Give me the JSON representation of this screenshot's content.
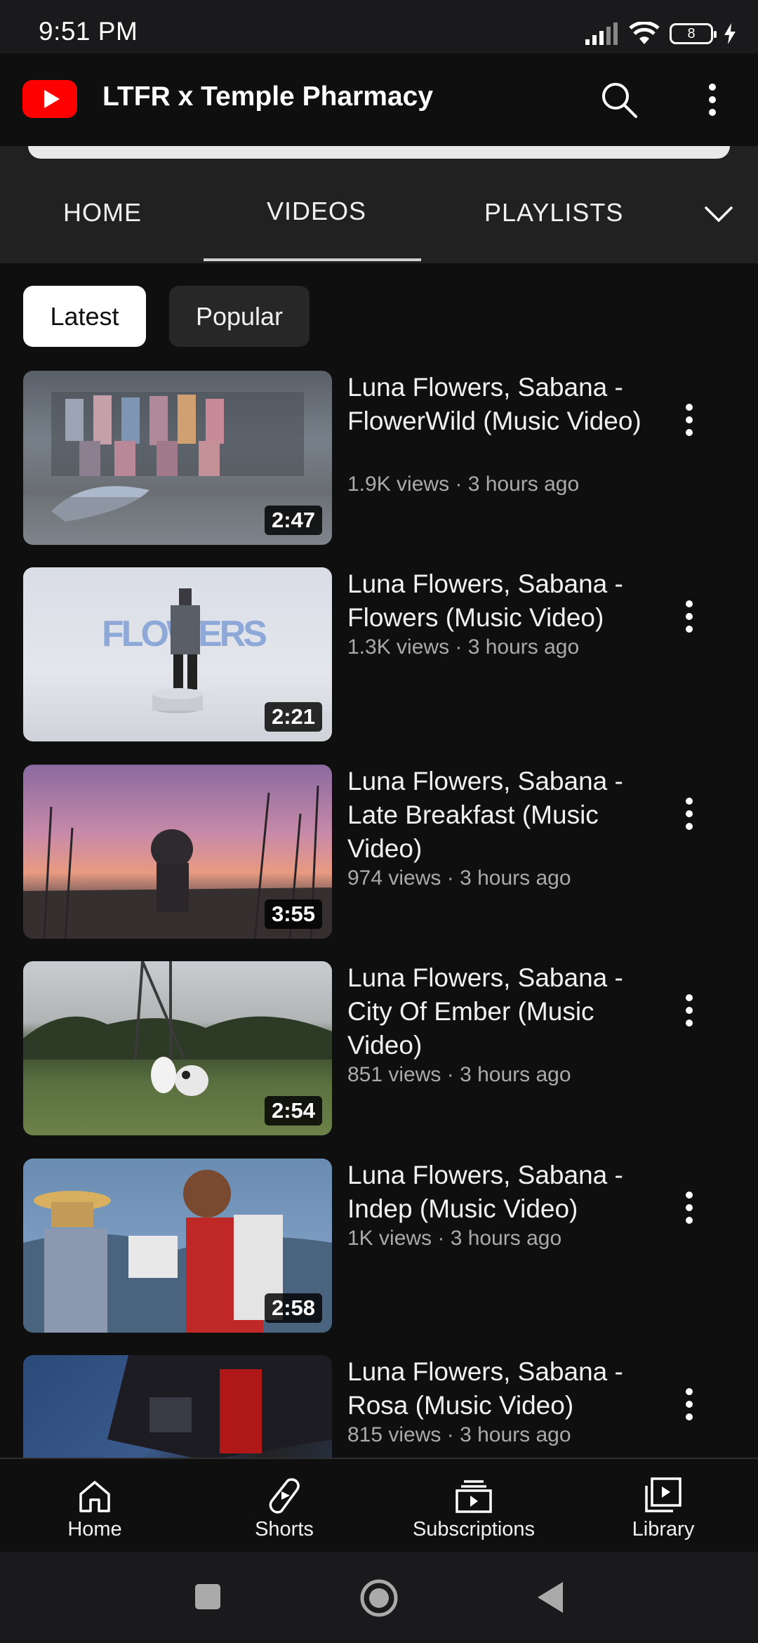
{
  "status_bar": {
    "time": "9:51 PM",
    "battery": "8"
  },
  "app_bar": {
    "channel_name": "LTFR x Temple Pharmacy"
  },
  "tabs": [
    {
      "label": "HOME"
    },
    {
      "label": "VIDEOS"
    },
    {
      "label": "PLAYLISTS"
    }
  ],
  "chips": [
    {
      "label": "Latest"
    },
    {
      "label": "Popular"
    }
  ],
  "videos": [
    {
      "title": "Luna Flowers, Sabana - FlowerWild (Music Video)",
      "meta": "1.9K views · 3 hours ago",
      "duration": "2:47"
    },
    {
      "title": "Luna Flowers, Sabana - Flowers (Music Video)",
      "meta": "1.3K views · 3 hours ago",
      "duration": "2:21"
    },
    {
      "title": "Luna Flowers, Sabana - Late Breakfast (Music Video)",
      "meta": "974 views · 3 hours ago",
      "duration": "3:55"
    },
    {
      "title": "Luna Flowers, Sabana - City Of Ember (Music Video)",
      "meta": "851 views · 3 hours ago",
      "duration": "2:54"
    },
    {
      "title": "Luna Flowers, Sabana - Indep (Music Video)",
      "meta": "1K views · 3 hours ago",
      "duration": "2:58"
    },
    {
      "title": "Luna Flowers, Sabana - Rosa (Music Video)",
      "meta": "815 views · 3 hours ago",
      "duration": ""
    }
  ],
  "bottom_nav": [
    {
      "label": "Home",
      "icon": "home-icon"
    },
    {
      "label": "Shorts",
      "icon": "shorts-icon"
    },
    {
      "label": "Subscriptions",
      "icon": "subscriptions-icon"
    },
    {
      "label": "Library",
      "icon": "library-icon"
    }
  ],
  "colors": {
    "brand_red": "#ff0000",
    "background": "#0f0f0f",
    "secondary_text": "#aaaaaa"
  }
}
